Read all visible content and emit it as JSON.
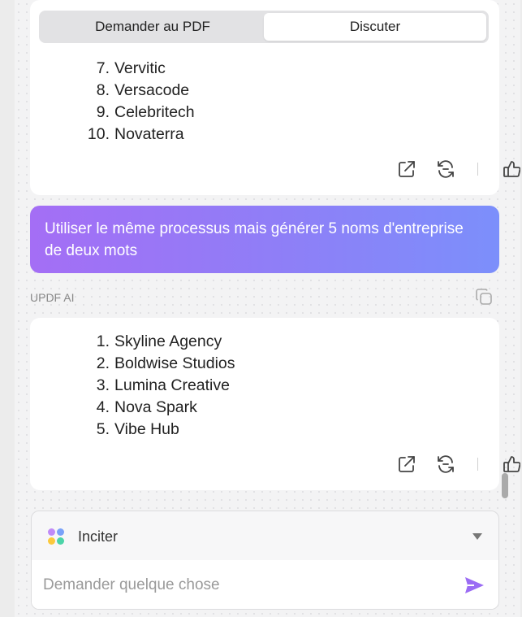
{
  "tabs": [
    {
      "label": "Demander au PDF",
      "active": false
    },
    {
      "label": "Discuter",
      "active": true
    }
  ],
  "messages": {
    "first_answer": {
      "items": [
        {
          "num": "7.",
          "name": "Vervitic"
        },
        {
          "num": "8.",
          "name": "Versacode"
        },
        {
          "num": "9.",
          "name": "Celebritech"
        },
        {
          "num": "10.",
          "name": "Novaterra"
        }
      ]
    },
    "user_message": "Utiliser le même processus mais générer 5 noms d'entreprise de deux mots",
    "ai_label": "UPDF AI",
    "second_answer": {
      "items": [
        {
          "num": "1.",
          "name": "Skyline Agency"
        },
        {
          "num": "2.",
          "name": "Boldwise Studios"
        },
        {
          "num": "3.",
          "name": "Lumina Creative"
        },
        {
          "num": "4.",
          "name": "Nova Spark"
        },
        {
          "num": "5.",
          "name": "Vibe Hub"
        }
      ]
    }
  },
  "action_icons": [
    "share-icon",
    "regenerate-icon",
    "thumbs-up-icon",
    "thumbs-down-icon"
  ],
  "composer": {
    "prompt_label": "Inciter",
    "input_value": "",
    "input_placeholder": "Demander quelque chose"
  },
  "colors": {
    "user_bubble_start": "#a46ef5",
    "user_bubble_end": "#7c8ffb",
    "send_icon": "#9b6cf4"
  }
}
